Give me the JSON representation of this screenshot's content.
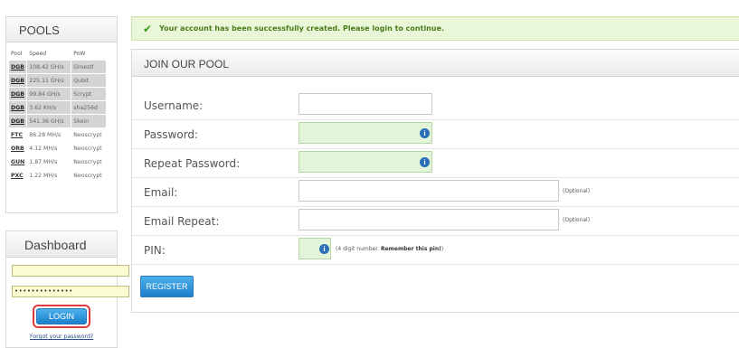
{
  "pools": {
    "title": "POOLS",
    "headers": [
      "Pool",
      "Speed",
      "PoW"
    ],
    "rows": [
      {
        "code": "DGB",
        "speed": "108.42 GH/s",
        "pow": "Groestl",
        "highlighted": true
      },
      {
        "code": "DGB",
        "speed": "225.11 GH/s",
        "pow": "Qubit",
        "highlighted": true
      },
      {
        "code": "DGB",
        "speed": "99.84 GH/s",
        "pow": "Scrypt",
        "highlighted": true
      },
      {
        "code": "DGB",
        "speed": "3.62 KH/s",
        "pow": "sha256d",
        "highlighted": true
      },
      {
        "code": "DGB",
        "speed": "541.36 GH/s",
        "pow": "Skein",
        "highlighted": true
      },
      {
        "code": "FTC",
        "speed": "86.28 MH/s",
        "pow": "Neoscrypt",
        "highlighted": false
      },
      {
        "code": "ORB",
        "speed": "4.12 MH/s",
        "pow": "Neoscrypt",
        "highlighted": false
      },
      {
        "code": "GUN",
        "speed": "1.87 MH/s",
        "pow": "Neoscrypt",
        "highlighted": false
      },
      {
        "code": "PXC",
        "speed": "1.22 MH/s",
        "pow": "Neoscrypt",
        "highlighted": false
      }
    ]
  },
  "dashboard": {
    "title": "Dashboard",
    "username_value": "",
    "password_value": "••••••••••••••",
    "login_label": "LOGIN",
    "forgot_label": "Forgot your password?"
  },
  "alert": {
    "icon": "check-icon",
    "message": "Your account has been successfully created. Please login to continue."
  },
  "join": {
    "title": "JOIN OUR POOL",
    "fields": {
      "username_label": "Username:",
      "password_label": "Password:",
      "repeat_password_label": "Repeat Password:",
      "email_label": "Email:",
      "email_repeat_label": "Email Repeat:",
      "pin_label": "PIN:",
      "optional": "(Optional)",
      "pin_hint_prefix": "(4 digit number.",
      "pin_hint_bold": "Remember this pin!",
      "pin_hint_suffix": ")"
    },
    "register_label": "REGISTER"
  },
  "colors": {
    "accent_blue": "#1b7fcc",
    "success_green": "#4b7a1a",
    "highlight_red": "#e03a3a",
    "field_green": "#e3f5d9"
  }
}
